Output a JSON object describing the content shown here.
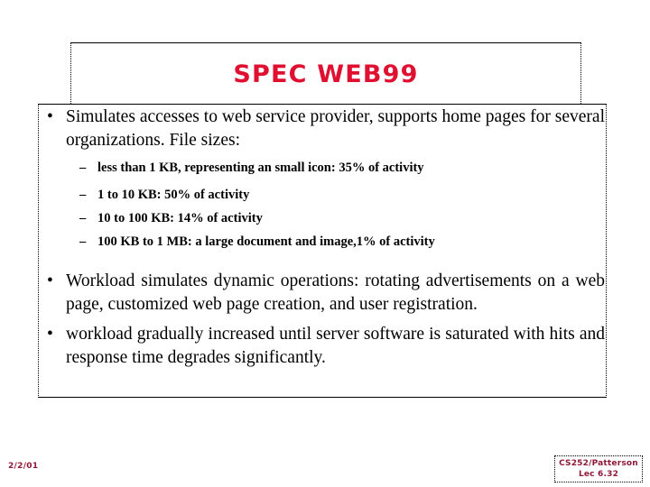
{
  "slide": {
    "title": "SPEC WEB99",
    "title_color": "#e01030",
    "footer_color": "#8f1838",
    "body": {
      "bullets": [
        {
          "level": 1,
          "marker": "•",
          "text": "Simulates accesses to web service provider, supports home pages for several organizations. File sizes:"
        },
        {
          "level": 2,
          "marker": "–",
          "text": "less than 1 KB, representing an small icon: 35% of activity"
        },
        {
          "level": 2,
          "marker": "–",
          "text": "1 to 10 KB: 50% of activity"
        },
        {
          "level": 2,
          "marker": "–",
          "text": "10 to 100 KB: 14% of activity"
        },
        {
          "level": 2,
          "marker": "–",
          "text": "100 KB to 1 MB: a large document and image,1% of activity"
        },
        {
          "level": 1,
          "marker": "•",
          "text": "Workload simulates dynamic operations: rotating advertisements on a web page, customized web page creation, and user registration."
        },
        {
          "level": 1,
          "marker": "•",
          "text": "workload gradually increased until server software is saturated with hits and response time degrades significantly."
        }
      ]
    }
  },
  "footer": {
    "date": "2/2/01",
    "course": "CS252/Patterson",
    "lecture": "Lec 6.32"
  }
}
